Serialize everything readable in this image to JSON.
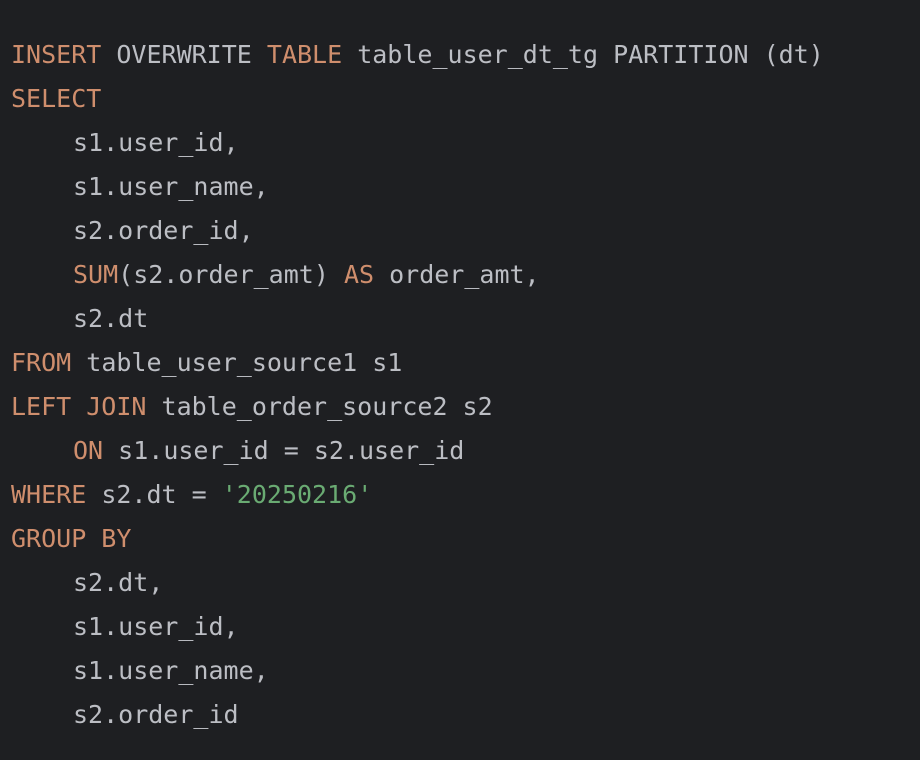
{
  "colors": {
    "background": "#1e1f22",
    "text": "#bcbec4",
    "keyword": "#cf8e6d",
    "string": "#6aab73"
  },
  "code_lines": [
    {
      "tokens": [
        {
          "text": "INSERT",
          "type": "kw"
        },
        {
          "text": " OVERWRITE ",
          "type": "txt"
        },
        {
          "text": "TABLE",
          "type": "kw"
        },
        {
          "text": " table_user_dt_tg PARTITION (dt)",
          "type": "txt"
        }
      ]
    },
    {
      "tokens": [
        {
          "text": "SELECT",
          "type": "kw"
        }
      ]
    },
    {
      "indent": true,
      "tokens": [
        {
          "text": "s1.user_id,",
          "type": "txt"
        }
      ]
    },
    {
      "indent": true,
      "tokens": [
        {
          "text": "s1.user_name,",
          "type": "txt"
        }
      ]
    },
    {
      "indent": true,
      "tokens": [
        {
          "text": "s2.order_id,",
          "type": "txt"
        }
      ]
    },
    {
      "indent": true,
      "tokens": [
        {
          "text": "SUM",
          "type": "kw"
        },
        {
          "text": "(s2.order_amt) ",
          "type": "txt"
        },
        {
          "text": "AS",
          "type": "kw"
        },
        {
          "text": " order_amt,",
          "type": "txt"
        }
      ]
    },
    {
      "indent": true,
      "tokens": [
        {
          "text": "s2.dt",
          "type": "txt"
        }
      ]
    },
    {
      "tokens": [
        {
          "text": "FROM",
          "type": "kw"
        },
        {
          "text": " table_user_source1 s1",
          "type": "txt"
        }
      ]
    },
    {
      "tokens": [
        {
          "text": "LEFT JOIN",
          "type": "kw"
        },
        {
          "text": " table_order_source2 s2",
          "type": "txt"
        }
      ]
    },
    {
      "indent": true,
      "tokens": [
        {
          "text": "ON",
          "type": "kw"
        },
        {
          "text": " s1.user_id = s2.user_id",
          "type": "txt"
        }
      ]
    },
    {
      "tokens": [
        {
          "text": "WHERE",
          "type": "kw"
        },
        {
          "text": " s2.dt = ",
          "type": "txt"
        },
        {
          "text": "'20250216'",
          "type": "str"
        }
      ]
    },
    {
      "tokens": [
        {
          "text": "GROUP BY",
          "type": "kw"
        }
      ]
    },
    {
      "indent": true,
      "tokens": [
        {
          "text": "s2.dt,",
          "type": "txt"
        }
      ]
    },
    {
      "indent": true,
      "tokens": [
        {
          "text": "s1.user_id,",
          "type": "txt"
        }
      ]
    },
    {
      "indent": true,
      "tokens": [
        {
          "text": "s1.user_name,",
          "type": "txt"
        }
      ]
    },
    {
      "indent": true,
      "tokens": [
        {
          "text": "s2.order_id",
          "type": "txt"
        }
      ]
    }
  ]
}
